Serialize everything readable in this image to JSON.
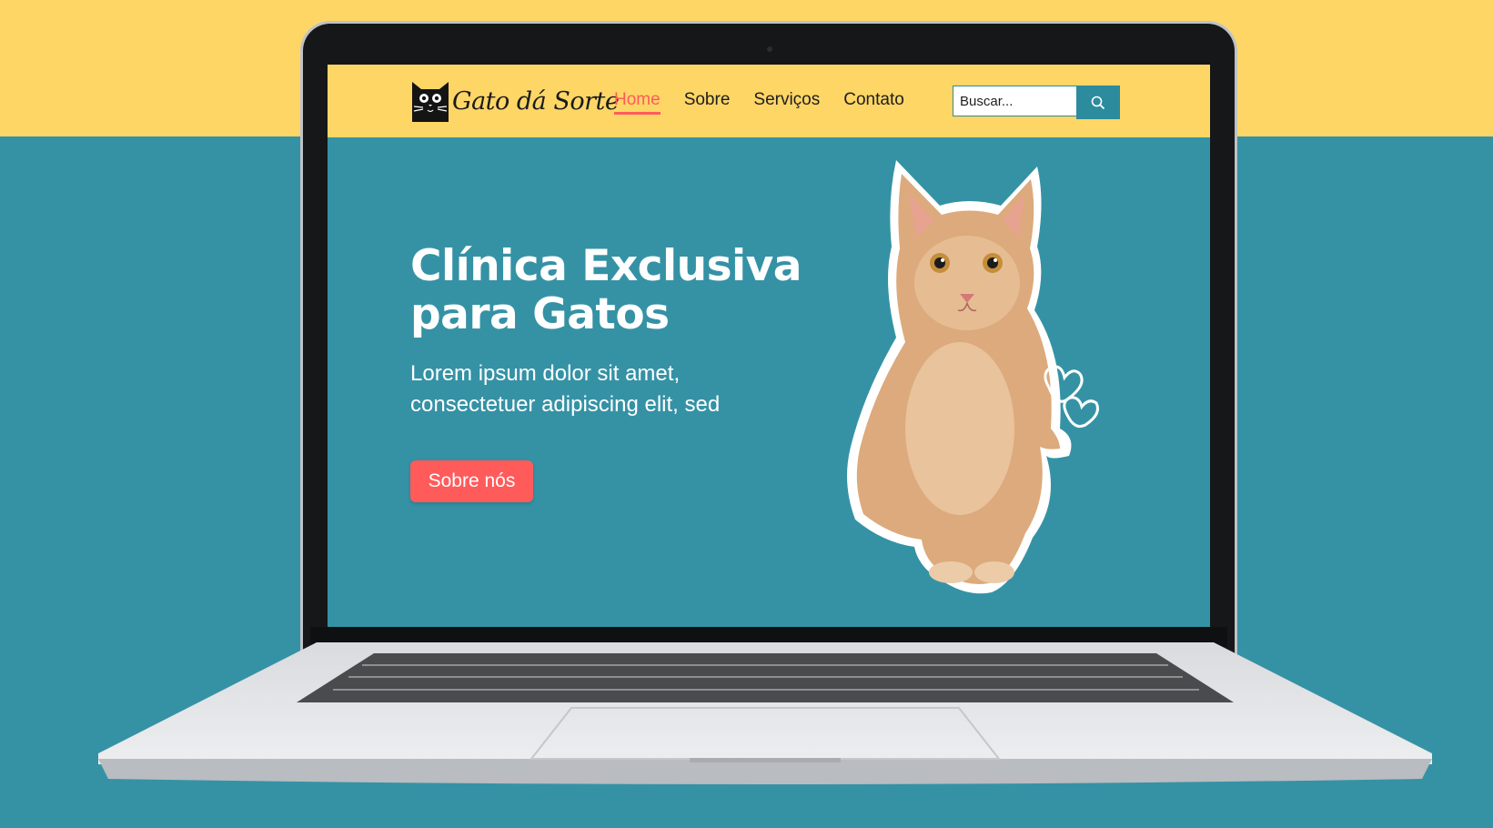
{
  "site": {
    "brand": "Gato dá Sorte",
    "nav": [
      {
        "label": "Home",
        "active": true
      },
      {
        "label": "Sobre",
        "active": false
      },
      {
        "label": "Serviços",
        "active": false
      },
      {
        "label": "Contato",
        "active": false
      }
    ],
    "search": {
      "placeholder": "Buscar...",
      "icon": "search-icon"
    },
    "hero": {
      "title_line1": "Clínica Exclusiva",
      "title_line2": "para Gatos",
      "subtitle_line1": "Lorem ipsum dolor sit amet,",
      "subtitle_line2": "consectetuer adipiscing elit, sed",
      "button_label": "Sobre nós"
    }
  },
  "colors": {
    "yellow": "#fed666",
    "teal": "#3592a5",
    "coral": "#ff5b5b",
    "search_button": "#2c8b9c"
  }
}
